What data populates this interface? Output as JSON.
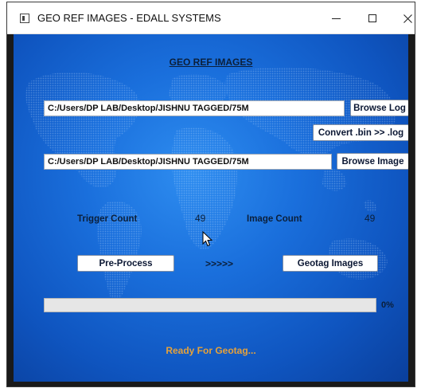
{
  "window": {
    "title": "GEO REF IMAGES - EDALL SYSTEMS"
  },
  "main": {
    "heading": "GEO REF IMAGES",
    "log_path": "C:/Users/DP LAB/Desktop/JISHNU TAGGED/75M",
    "browse_log_label": "Browse Log",
    "convert_label": "Convert .bin >> .log",
    "image_path": "C:/Users/DP LAB/Desktop/JISHNU TAGGED/75M",
    "browse_image_label": "Browse Image",
    "trigger_count_label": "Trigger Count",
    "trigger_count_value": "49",
    "image_count_label": "Image Count",
    "image_count_value": "49",
    "preprocess_label": "Pre-Process",
    "arrows": ">>>>>",
    "geotag_label": "Geotag Images",
    "progress_fraction": 0,
    "progress_text": "0%",
    "status": "Ready For Geotag..."
  },
  "icons": {
    "app": "app-window-icon",
    "minimize": "minimize-icon",
    "maximize": "maximize-icon",
    "close": "close-icon",
    "cursor": "mouse-pointer-icon"
  },
  "colors": {
    "background_blue": "#1a6fdc",
    "status_text": "#e6a23a",
    "label_text": "#0b1f3a"
  }
}
